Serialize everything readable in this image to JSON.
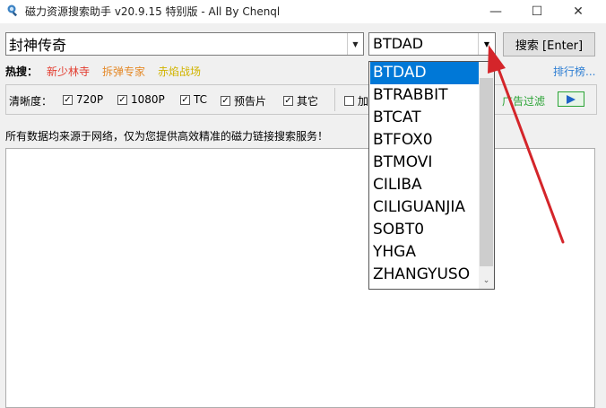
{
  "window": {
    "title": "磁力资源搜索助手 v20.9.15 特别版 - All By Chenql",
    "controls": {
      "minimize": "—",
      "maximize": "☐",
      "close": "✕"
    }
  },
  "search": {
    "value": "封神传奇",
    "dropdown_arrow": "▼",
    "site_selected": "BTDAD",
    "site_arrow": "▼",
    "button_label": "搜索 [Enter]"
  },
  "hot": {
    "label": "热搜：",
    "items": [
      "新少林寺",
      "拆弹专家",
      "赤焰战场"
    ],
    "colors": [
      "#e23b2e",
      "#e48a2a",
      "#d1b400"
    ],
    "rank_link": "排行榜..."
  },
  "filters": {
    "clarity_label": "清晰度：",
    "options": [
      {
        "label": "720P",
        "checked": true
      },
      {
        "label": "1080P",
        "checked": true
      },
      {
        "label": "TC",
        "checked": true
      },
      {
        "label": "预告片",
        "checked": true
      },
      {
        "label": "其它",
        "checked": true
      }
    ],
    "add_label": "加",
    "ad_filter": "广告过滤"
  },
  "notice": "所有数据均来源于网络，仅为您提供高效精准的磁力链接搜索服务！",
  "dropdown": {
    "items": [
      "BTDAD",
      "BTRABBIT",
      "BTCAT",
      "BTFOX0",
      "BTMOVI",
      "CILIBA",
      "CILIGUANJIA",
      "SOBT0",
      "YHGA",
      "ZHANGYUSO"
    ],
    "selected_index": 0,
    "scroll_down": "⌄"
  },
  "colors": {
    "accent": "#0078d7",
    "annotation_arrow": "#d4252a"
  }
}
